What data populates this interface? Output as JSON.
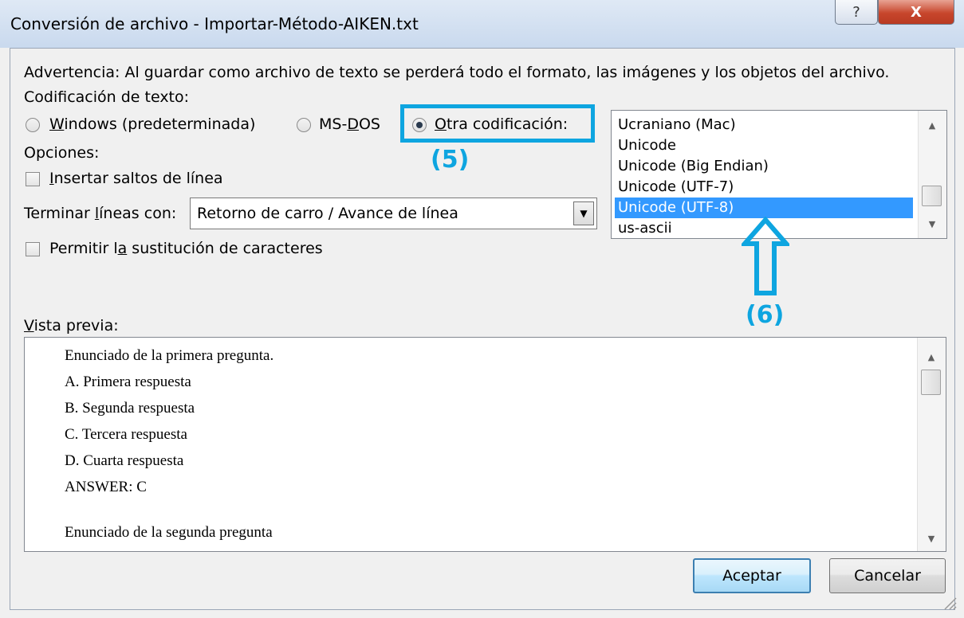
{
  "window": {
    "title": "Conversión de archivo - Importar-Método-AIKEN.txt",
    "help_label": "?",
    "close_label": "X"
  },
  "warning": "Advertencia: Al guardar como archivo de texto se perderá todo el formato, las imágenes y los objetos del archivo.",
  "encoding": {
    "label": "Codificación de texto:",
    "options": [
      {
        "label_ul": "W",
        "label_rest": "indows (predeterminada)",
        "checked": false
      },
      {
        "label_pre": "MS-",
        "label_ul": "D",
        "label_rest": "OS",
        "checked": false
      },
      {
        "label_ul": "O",
        "label_rest": "tra codificación:",
        "checked": true
      }
    ],
    "list": {
      "items": [
        "Ucraniano (Mac)",
        "Unicode",
        "Unicode (Big Endian)",
        "Unicode (UTF-7)",
        "Unicode (UTF-8)",
        "us-ascii"
      ],
      "selected": "Unicode (UTF-8)"
    }
  },
  "options": {
    "label": "Opciones:",
    "insert_breaks": {
      "label_ul": "I",
      "label_rest": "nsertar saltos de línea",
      "checked": false
    },
    "end_lines": {
      "label_pre": "Terminar ",
      "label_ul": "l",
      "label_rest": "íneas con:",
      "value": "Retorno de carro / Avance de línea"
    },
    "allow_sub": {
      "label_pre": "Permitir l",
      "label_ul": "a",
      "label_rest": " sustitución de caracteres",
      "checked": false
    }
  },
  "annotations": {
    "step5": "(5)",
    "step6": "(6)"
  },
  "preview": {
    "label_ul": "V",
    "label_rest": "ista previa:",
    "lines": [
      "Enunciado de la primera pregunta.",
      "A. Primera respuesta",
      "B. Segunda respuesta",
      "C. Tercera respuesta",
      "D. Cuarta respuesta",
      "ANSWER: C",
      "",
      "Enunciado de la segunda pregunta"
    ]
  },
  "buttons": {
    "ok": "Aceptar",
    "cancel": "Cancelar"
  },
  "colors": {
    "accent_annotation": "#0ea5e0",
    "selection": "#3399ff"
  },
  "icons": {
    "arrow": "up-arrow-outline-icon",
    "resize": "resize-grip-icon"
  }
}
